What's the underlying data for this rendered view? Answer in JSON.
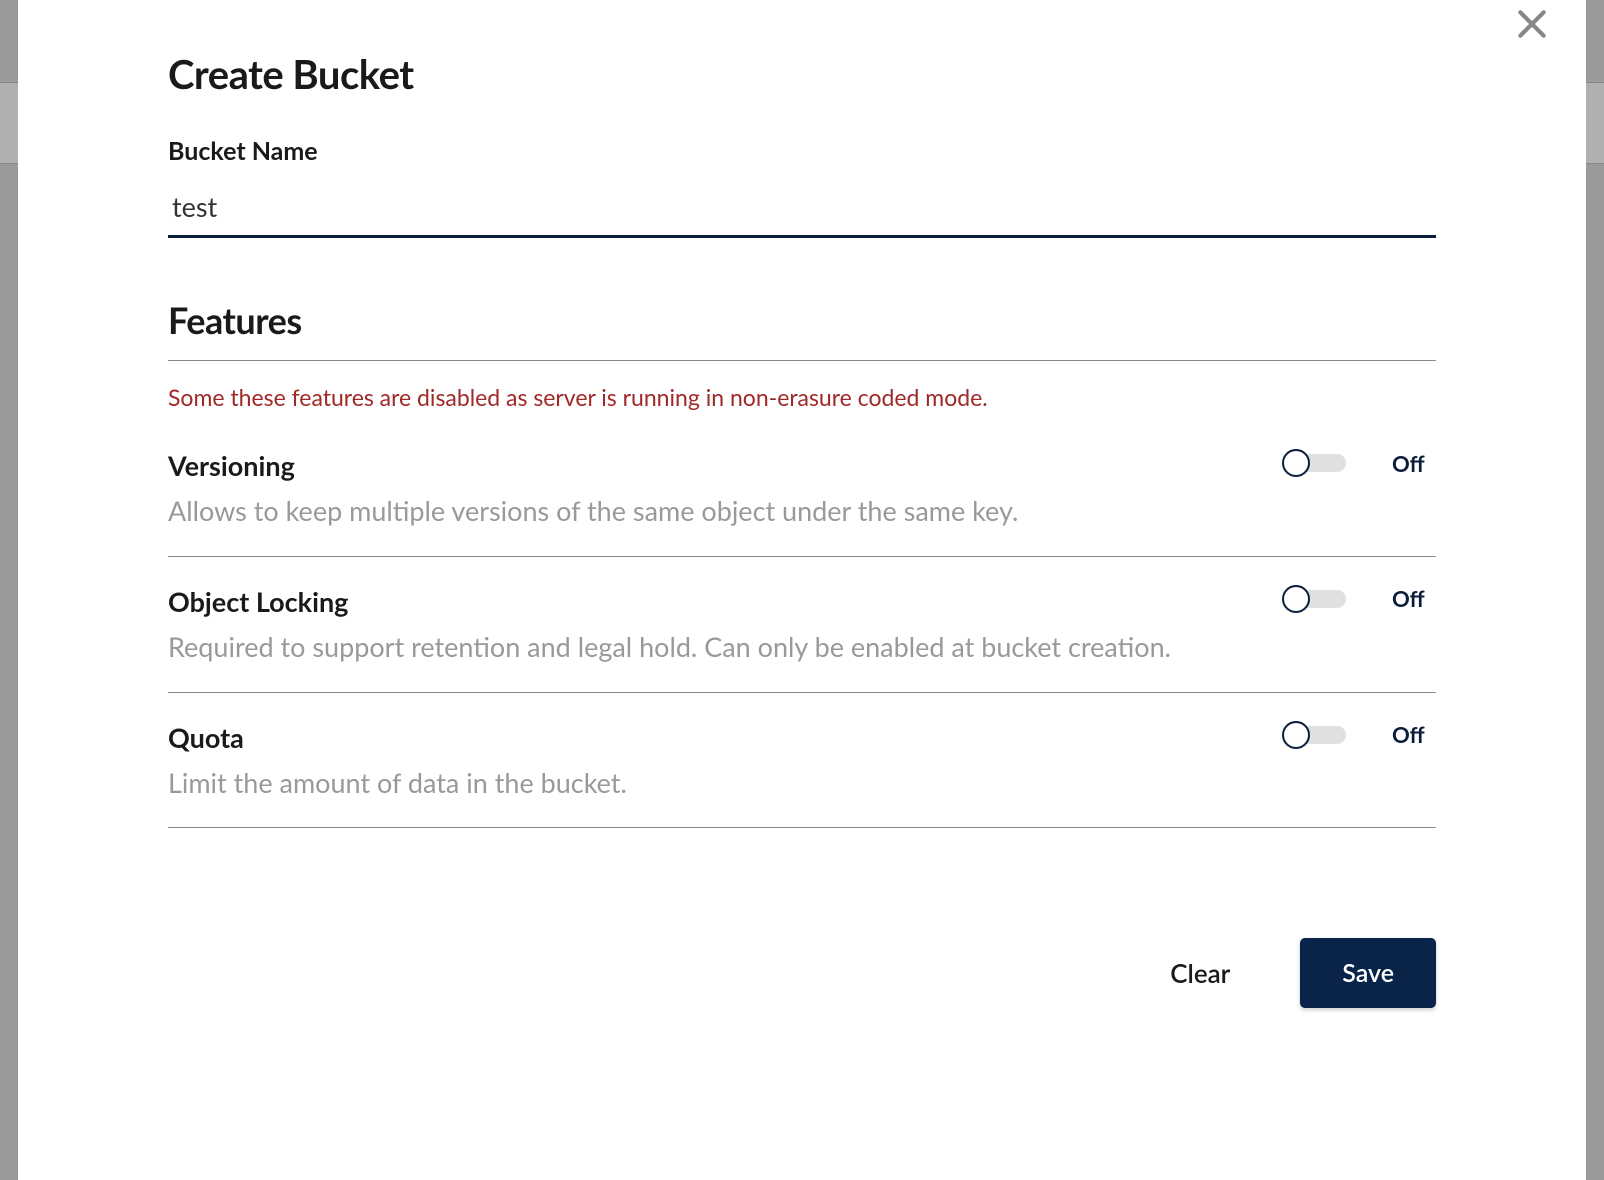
{
  "modal": {
    "title": "Create Bucket",
    "bucketName": {
      "label": "Bucket Name",
      "value": "test"
    },
    "featuresSection": {
      "title": "Features",
      "warning": "Some these features are disabled as server is running in non-erasure coded mode."
    },
    "features": [
      {
        "title": "Versioning",
        "description": "Allows to keep multiple versions of the same object under the same key.",
        "state": "Off"
      },
      {
        "title": "Object Locking",
        "description": "Required to support retention and legal hold. Can only be enabled at bucket creation.",
        "state": "Off"
      },
      {
        "title": "Quota",
        "description": "Limit the amount of data in the bucket.",
        "state": "Off"
      }
    ],
    "buttons": {
      "clear": "Clear",
      "save": "Save"
    }
  }
}
